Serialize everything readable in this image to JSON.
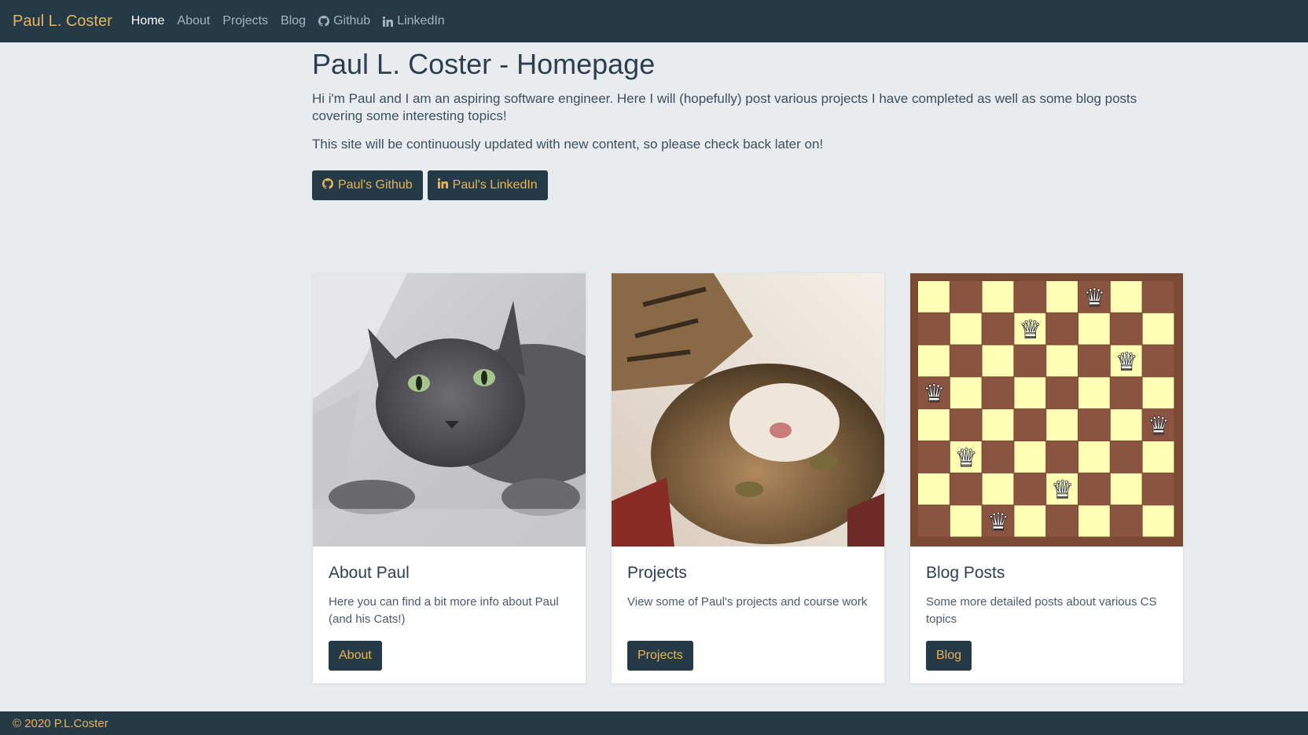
{
  "nav": {
    "brand": "Paul L. Coster",
    "links": [
      {
        "label": "Home"
      },
      {
        "label": "About"
      },
      {
        "label": "Projects"
      },
      {
        "label": "Blog"
      },
      {
        "label": "Github",
        "icon": "github-icon"
      },
      {
        "label": "LinkedIn",
        "icon": "linkedin-icon"
      }
    ]
  },
  "hero": {
    "title": "Paul L. Coster - Homepage",
    "intro": "Hi i'm Paul and I am an aspiring software engineer. Here I will (hopefully) post various projects I have completed as well as some blog posts covering some interesting topics!",
    "update_note": "This site will be continuously updated with new content, so please check back later on!",
    "buttons": [
      {
        "label": "Paul's Github",
        "icon": "github-icon"
      },
      {
        "label": "Paul's LinkedIn",
        "icon": "linkedin-icon"
      }
    ]
  },
  "cards": [
    {
      "title": "About Paul",
      "text": "Here you can find a bit more info about Paul (and his Cats!)",
      "button": "About",
      "image": "grey-cat-photo"
    },
    {
      "title": "Projects",
      "text": "View some of Paul's projects and course work",
      "button": "Projects",
      "image": "tabby-cat-photo"
    },
    {
      "title": "Blog Posts",
      "text": "Some more detailed posts about various CS topics",
      "button": "Blog",
      "image": "eight-queens-chessboard"
    }
  ],
  "footer": {
    "text": "© 2020 P.L.Coster"
  },
  "colors": {
    "navbar": "#243b47",
    "accent": "#e8b35a",
    "background": "#e8ecef",
    "board_light": "#fefeb4",
    "board_dark": "#8a5440"
  }
}
